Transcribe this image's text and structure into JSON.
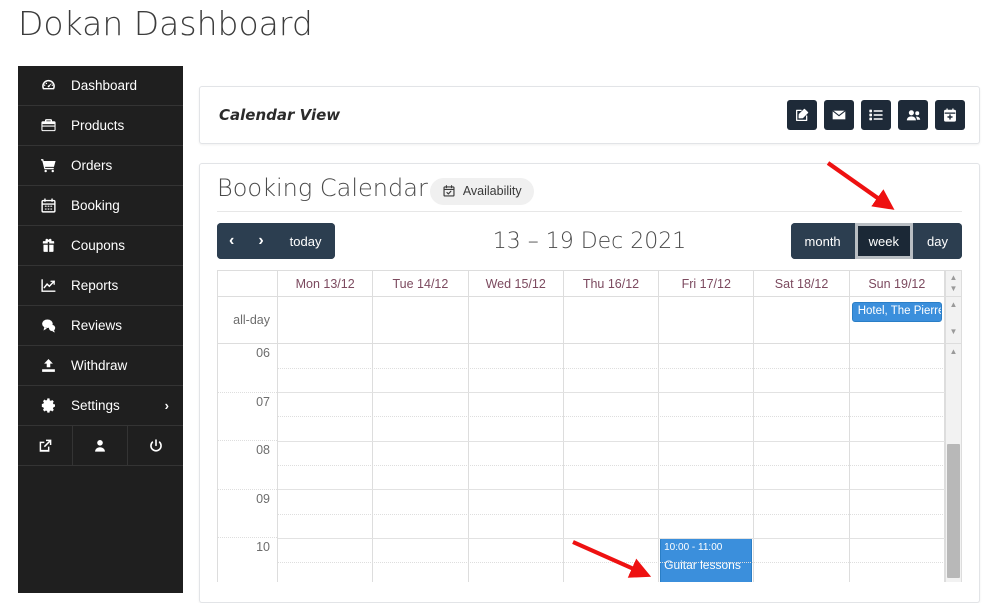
{
  "page": {
    "title": "Dokan Dashboard"
  },
  "sidebar": {
    "items": [
      {
        "label": "Dashboard",
        "icon": "dashboard-gauge-icon"
      },
      {
        "label": "Products",
        "icon": "briefcase-icon"
      },
      {
        "label": "Orders",
        "icon": "shopping-cart-icon"
      },
      {
        "label": "Booking",
        "icon": "calendar-icon"
      },
      {
        "label": "Coupons",
        "icon": "gift-icon"
      },
      {
        "label": "Reports",
        "icon": "chart-line-icon"
      },
      {
        "label": "Reviews",
        "icon": "comment-icon"
      },
      {
        "label": "Withdraw",
        "icon": "upload-icon"
      },
      {
        "label": "Settings",
        "icon": "gear-icon",
        "chevron": "›"
      }
    ],
    "footer_icons": [
      {
        "name": "external-link-icon"
      },
      {
        "name": "user-icon"
      },
      {
        "name": "power-icon"
      }
    ]
  },
  "calendar_view_panel": {
    "title": "Calendar View",
    "actions": [
      {
        "name": "edit-booking-icon",
        "title": "Edit"
      },
      {
        "name": "envelope-icon",
        "title": "Mail"
      },
      {
        "name": "list-icon",
        "title": "List"
      },
      {
        "name": "users-icon",
        "title": "Customers"
      },
      {
        "name": "calendar-plus-icon",
        "title": "Add booking"
      }
    ]
  },
  "booking_panel": {
    "title": "Booking Calendar",
    "availability_button": {
      "label": "Availability",
      "icon": "calendar-check-icon"
    },
    "toolbar": {
      "prev_label": "‹",
      "next_label": "›",
      "today_label": "today",
      "range_title": "13 – 19 Dec 2021",
      "views": [
        {
          "label": "month",
          "active": false
        },
        {
          "label": "week",
          "active": true
        },
        {
          "label": "day",
          "active": false
        }
      ]
    },
    "calendar": {
      "allday_label": "all-day",
      "day_headers": [
        "Mon 13/12",
        "Tue 14/12",
        "Wed 15/12",
        "Thu 16/12",
        "Fri 17/12",
        "Sat 18/12",
        "Sun 19/12"
      ],
      "hour_labels": [
        "06",
        "07",
        "08",
        "09",
        "10"
      ],
      "allday_events": [
        {
          "title": "Hotel, The Pierre",
          "day_index": 6,
          "color": "#3b8fdc"
        }
      ],
      "timed_events": [
        {
          "time": "10:00 - 11:00",
          "title": "Guitar lessons",
          "day_index": 4,
          "start_hour": "10:00",
          "end_hour": "11:00",
          "color": "#3b8fdc"
        }
      ]
    }
  },
  "annotations": {
    "arrow_color": "#ee1111",
    "arrows": [
      {
        "name": "arrow-to-week-button"
      },
      {
        "name": "arrow-to-guitar-lessons-event"
      }
    ]
  },
  "colors": {
    "sidebar_bg": "#1f1f1f",
    "toolbar_btn": "#2c3e50",
    "toolbar_btn_active": "#1b2836",
    "action_icon_bg": "#1e2a38",
    "day_header_text": "#7c4a5f",
    "event_blue": "#3b8fdc"
  }
}
